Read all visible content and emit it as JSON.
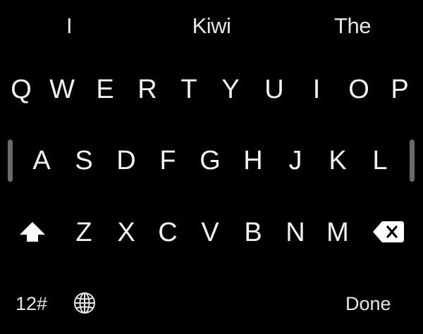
{
  "suggestions": [
    "I",
    "Kiwi",
    "The"
  ],
  "rows": [
    [
      "Q",
      "W",
      "E",
      "R",
      "T",
      "Y",
      "U",
      "I",
      "O",
      "P"
    ],
    [
      "A",
      "S",
      "D",
      "F",
      "G",
      "H",
      "J",
      "K",
      "L"
    ],
    [
      "Z",
      "X",
      "C",
      "V",
      "B",
      "N",
      "M"
    ]
  ],
  "function_keys": {
    "numbers_label": "12#",
    "globe_icon": "globe-icon",
    "shift_icon": "shift-arrow-icon",
    "delete_icon": "delete-backspace-icon",
    "done_label": "Done"
  },
  "colors": {
    "background": "#000000",
    "key_text": "#f2f2f2",
    "scroll_bar": "#6a6a6a"
  }
}
